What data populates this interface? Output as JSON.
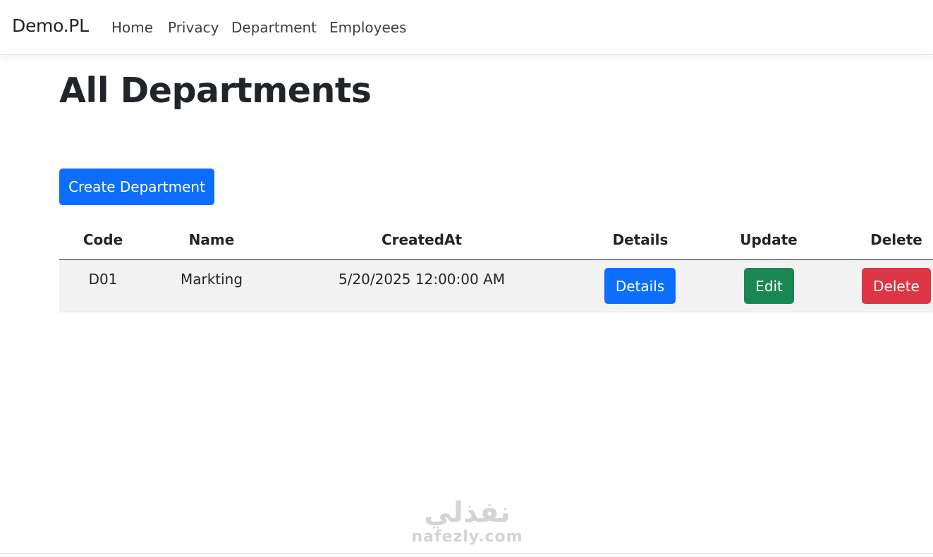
{
  "navbar": {
    "brand": "Demo.PL",
    "links": [
      "Home",
      "Privacy",
      "Department",
      "Employees"
    ]
  },
  "page": {
    "title": "All Departments",
    "create_button": "Create Department"
  },
  "table": {
    "columns": [
      "Code",
      "Name",
      "CreatedAt",
      "Details",
      "Update",
      "Delete"
    ],
    "rows": [
      {
        "code": "D01",
        "name": "Markting",
        "created_at": "5/20/2025 12:00:00 AM",
        "details_label": "Details",
        "edit_label": "Edit",
        "delete_label": "Delete"
      }
    ]
  },
  "watermark": {
    "arabic": "نفذلي",
    "latin": "nafezly.com"
  },
  "colors": {
    "primary": "#0d6efd",
    "success": "#198754",
    "danger": "#dc3545",
    "row_stripe": "#f2f2f2"
  }
}
